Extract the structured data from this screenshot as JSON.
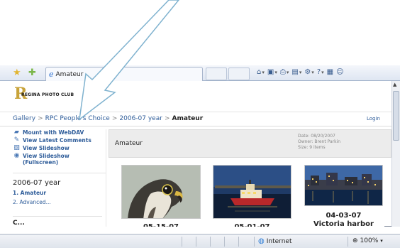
{
  "browser": {
    "tab_title": "Amateur",
    "command_bar": [
      {
        "icon": "home-icon",
        "name": "home"
      },
      {
        "icon": "feeds-icon",
        "name": "feeds"
      },
      {
        "icon": "print-icon",
        "name": "print"
      },
      {
        "icon": "page-icon",
        "name": "page"
      },
      {
        "icon": "tools-icon",
        "name": "tools"
      },
      {
        "icon": "help-icon",
        "name": "help"
      },
      {
        "icon": "research-icon",
        "name": "research"
      },
      {
        "icon": "messenger-icon",
        "name": "messenger"
      }
    ]
  },
  "logo": {
    "letter": "R",
    "club_name": "REGINA PHOTO CLUB"
  },
  "breadcrumb": {
    "items": [
      "Gallery",
      "RPC People's Choice",
      "2006-07 year"
    ],
    "current": "Amateur",
    "separator": ">"
  },
  "login_label": "Login",
  "sidebar": {
    "links": [
      {
        "label": "Mount with WebDAV",
        "icon": "folder-icon"
      },
      {
        "label": "View Latest Comments",
        "icon": "comment-icon"
      },
      {
        "label": "View Slideshow",
        "icon": "slideshow-icon"
      },
      {
        "label": "View Slideshow (Fullscreen)",
        "icon": "fullscreen-icon"
      }
    ],
    "album_title": "2006-07 year",
    "sub_items": [
      {
        "label": "1. Amateur",
        "active": true
      },
      {
        "label": "2. Advanced...",
        "active": false
      }
    ],
    "section_2_title": "C..."
  },
  "main": {
    "title": "Amateur",
    "meta": {
      "date": "Date: 08/20/2007",
      "owner": "Owner: Brent Parkin",
      "size": "Size: 9 items"
    },
    "items": [
      {
        "date": "05-15-07",
        "title": ""
      },
      {
        "date": "05-01-07",
        "title": ""
      },
      {
        "date": "04-03-07",
        "title": "Victoria harbor"
      }
    ]
  },
  "status": {
    "zone": "Internet",
    "zoom": "100%"
  },
  "colors": {
    "link": "#2f5d9a",
    "arrow": "#7fb2cf",
    "header_bg": "#ececec"
  }
}
